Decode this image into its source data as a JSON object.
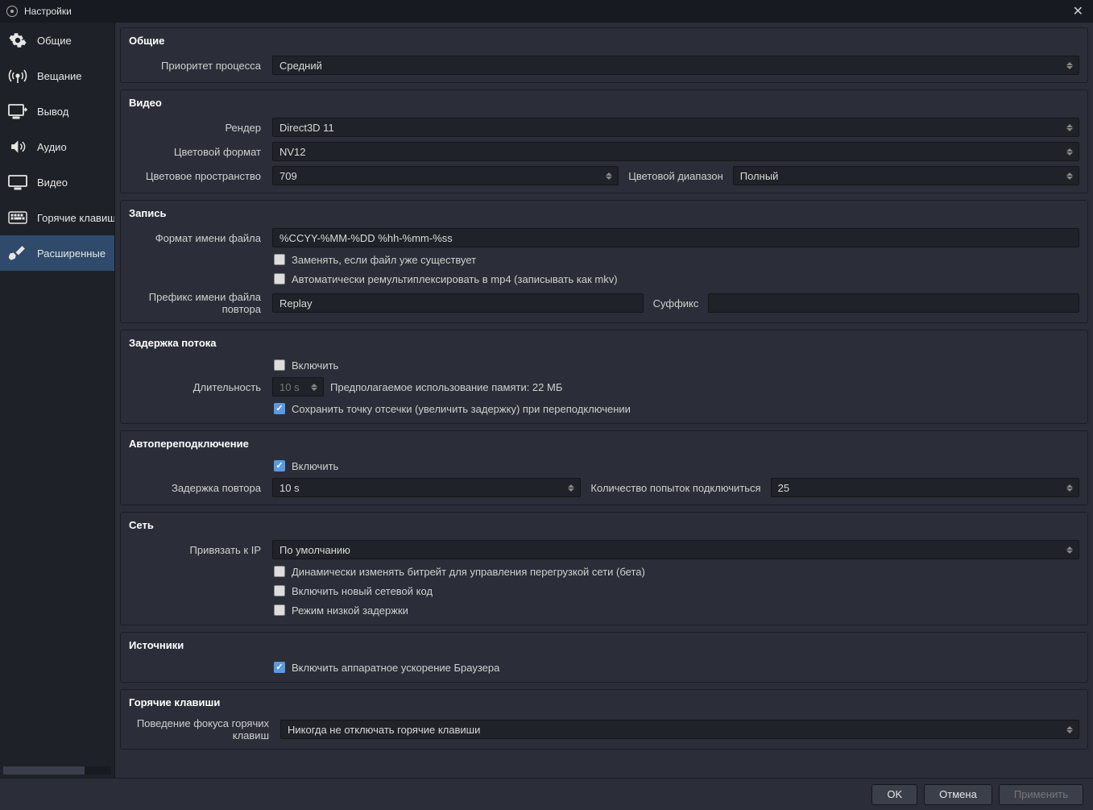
{
  "window": {
    "title": "Настройки"
  },
  "sidebar": {
    "items": [
      {
        "label": "Общие"
      },
      {
        "label": "Вещание"
      },
      {
        "label": "Вывод"
      },
      {
        "label": "Аудио"
      },
      {
        "label": "Видео"
      },
      {
        "label": "Горячие клавиши"
      },
      {
        "label": "Расширенные"
      }
    ]
  },
  "groups": {
    "general": {
      "title": "Общие",
      "priority_label": "Приоритет процесса",
      "priority_value": "Средний"
    },
    "video": {
      "title": "Видео",
      "renderer_label": "Рендер",
      "renderer_value": "Direct3D 11",
      "color_format_label": "Цветовой формат",
      "color_format_value": "NV12",
      "color_space_label": "Цветовое пространство",
      "color_space_value": "709",
      "color_range_label": "Цветовой диапазон",
      "color_range_value": "Полный"
    },
    "recording": {
      "title": "Запись",
      "filename_format_label": "Формат имени файла",
      "filename_format_value": "%CCYY-%MM-%DD %hh-%mm-%ss",
      "overwrite_label": "Заменять, если файл уже существует",
      "remux_label": "Автоматически ремультиплексировать в mp4 (записывать как mkv)",
      "replay_prefix_label": "Префикс имени файла повтора",
      "replay_prefix_value": "Replay",
      "suffix_label": "Суффикс",
      "suffix_value": ""
    },
    "stream_delay": {
      "title": "Задержка потока",
      "enable_label": "Включить",
      "duration_label": "Длительность",
      "duration_value": "10 s",
      "memory_label": "Предполагаемое использование памяти: 22 МБ",
      "preserve_label": "Сохранить точку отсечки (увеличить задержку) при переподключении"
    },
    "reconnect": {
      "title": "Автопереподключение",
      "enable_label": "Включить",
      "retry_delay_label": "Задержка повтора",
      "retry_delay_value": "10 s",
      "max_retries_label": "Количество попыток подключиться",
      "max_retries_value": "25"
    },
    "network": {
      "title": "Сеть",
      "bind_label": "Привязать к IP",
      "bind_value": "По умолчанию",
      "dyn_bitrate_label": "Динамически изменять битрейт для управления перегрузкой сети (бета)",
      "new_code_label": "Включить новый сетевой код",
      "low_latency_label": "Режим низкой задержки"
    },
    "sources": {
      "title": "Источники",
      "hw_accel_label": "Включить аппаратное ускорение Браузера"
    },
    "hotkeys": {
      "title": "Горячие клавиши",
      "focus_label": "Поведение фокуса горячих клавиш",
      "focus_value": "Никогда не отключать горячие клавиши"
    }
  },
  "footer": {
    "ok": "OK",
    "cancel": "Отмена",
    "apply": "Применить"
  }
}
